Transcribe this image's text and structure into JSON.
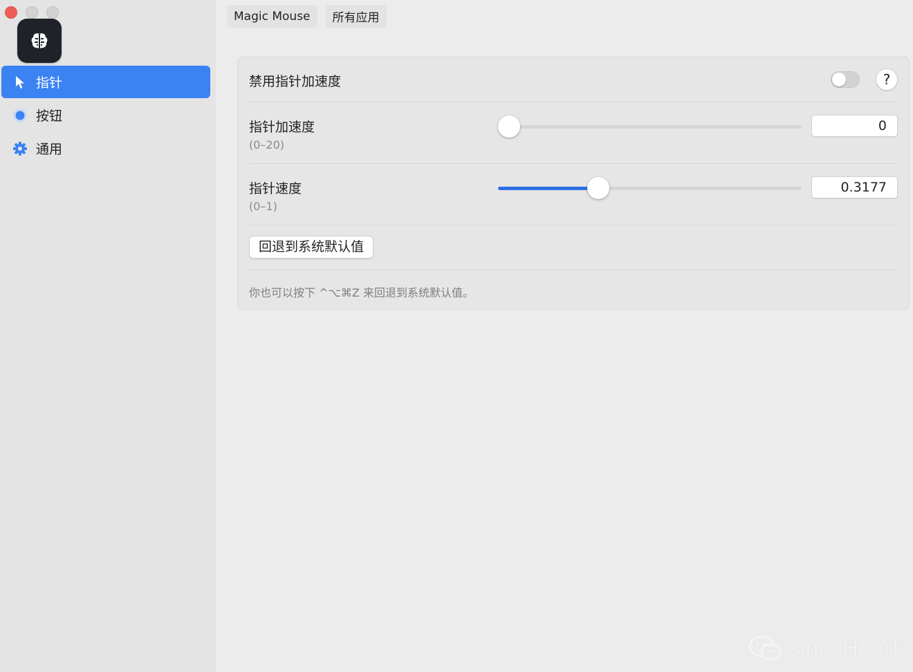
{
  "window": {
    "traffic_lights": [
      "close",
      "minimize",
      "maximize"
    ]
  },
  "app_icon": {
    "name": "brain-icon"
  },
  "sidebar": {
    "items": [
      {
        "label": "指针",
        "icon": "pointer-arrow-icon",
        "active": true
      },
      {
        "label": "按钮",
        "icon": "radio-button-icon",
        "active": false
      },
      {
        "label": "通用",
        "icon": "gear-icon",
        "active": false
      }
    ]
  },
  "tabs": [
    {
      "label": "Magic Mouse"
    },
    {
      "label": "所有应用"
    }
  ],
  "panel": {
    "disable_accel": {
      "label": "禁用指针加速度",
      "enabled": false,
      "help": "?"
    },
    "accel": {
      "label": "指针加速度",
      "range": "(0–20)",
      "value": "0",
      "min": 0,
      "max": 20,
      "current": 0
    },
    "speed": {
      "label": "指针速度",
      "range": "(0–1)",
      "value": "0.3177",
      "min": 0,
      "max": 1,
      "current": 0.3177
    },
    "reset_button": "回退到系统默认值",
    "hint": "你也可以按下 ^⌥⌘Z 来回退到系统默认值。"
  },
  "watermark": {
    "text": "sinceHeart"
  },
  "colors": {
    "accent": "#3b82f3",
    "slider_fill": "#2f6fe4",
    "close": "#ee5d55"
  }
}
